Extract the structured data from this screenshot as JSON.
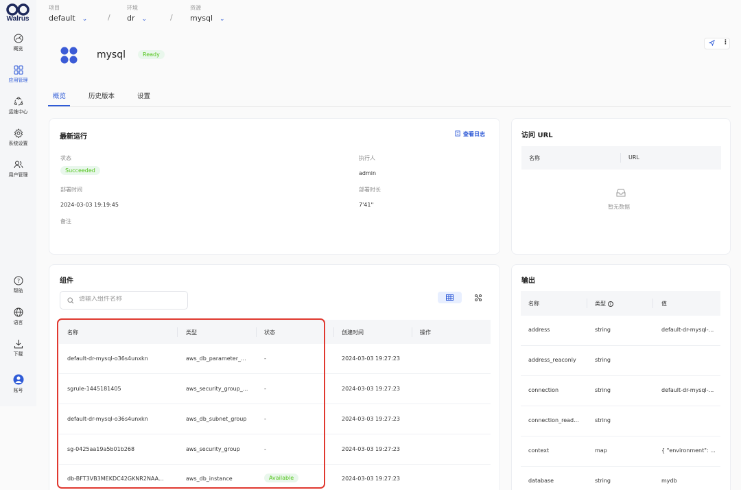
{
  "app": {
    "logo_text": "Walrus"
  },
  "sidebar": {
    "items": [
      {
        "label": "概览",
        "icon": "dashboard-icon"
      },
      {
        "label": "应用管理",
        "icon": "apps-grid-icon"
      },
      {
        "label": "运维中心",
        "icon": "ops-center-icon"
      },
      {
        "label": "系统设置",
        "icon": "gear-icon"
      },
      {
        "label": "用户管理",
        "icon": "users-icon"
      }
    ],
    "bottom": [
      {
        "label": "帮助",
        "icon": "help-icon"
      },
      {
        "label": "语言",
        "icon": "globe-icon"
      },
      {
        "label": "下载",
        "icon": "download-icon"
      },
      {
        "label": "账号",
        "icon": "account-icon"
      }
    ]
  },
  "breadcrumb": [
    {
      "label": "项目",
      "value": "default"
    },
    {
      "label": "环境",
      "value": "dr"
    },
    {
      "label": "资源",
      "value": "mysql"
    }
  ],
  "resource": {
    "name": "mysql",
    "status": "Ready"
  },
  "tabs": [
    "概览",
    "历史版本",
    "设置"
  ],
  "latest_run": {
    "title": "最新运行",
    "view_logs": "查看日志",
    "status_label": "状态",
    "status_value": "Succeeded",
    "executor_label": "执行人",
    "executor_value": "admin",
    "deploy_time_label": "部署时间",
    "deploy_time_value": "2024-03-03 19:19:45",
    "duration_label": "部署时长",
    "duration_value": "7'41''",
    "notes_label": "备注"
  },
  "access_url": {
    "title": "访问 URL",
    "columns": [
      "名称",
      "URL"
    ],
    "empty_text": "暂无数据"
  },
  "components": {
    "title": "组件",
    "search_placeholder": "请输入组件名称",
    "columns": [
      "名称",
      "类型",
      "状态",
      "创建时间",
      "操作"
    ],
    "rows": [
      {
        "name": "default-dr-mysql-o36s4unxkn",
        "type": "aws_db_parameter_...",
        "status": "-",
        "created": "2024-03-03 19:27:23"
      },
      {
        "name": "sgrule-1445181405",
        "type": "aws_security_group_...",
        "status": "-",
        "created": "2024-03-03 19:27:23"
      },
      {
        "name": "default-dr-mysql-o36s4unxkn",
        "type": "aws_db_subnet_group",
        "status": "-",
        "created": "2024-03-03 19:27:23"
      },
      {
        "name": "sg-0425aa19a5b01b268",
        "type": "aws_security_group",
        "status": "-",
        "created": "2024-03-03 19:27:23"
      },
      {
        "name": "db-BFT3VB3MEKDC42GKNR2NAA...",
        "type": "aws_db_instance",
        "status": "Available",
        "created": "2024-03-03 19:27:23"
      }
    ]
  },
  "outputs": {
    "title": "输出",
    "columns": [
      "名称",
      "类型",
      "值"
    ],
    "rows": [
      {
        "name": "address",
        "type": "string",
        "value": "default-dr-mysql-..."
      },
      {
        "name": "address_reaconly",
        "type": "string",
        "value": ""
      },
      {
        "name": "connection",
        "type": "string",
        "value": "default-dr-mysql-..."
      },
      {
        "name": "connection_read...",
        "type": "string",
        "value": ""
      },
      {
        "name": "context",
        "type": "map",
        "value": "{ \"environment\": ..."
      },
      {
        "name": "database",
        "type": "string",
        "value": "mydb"
      }
    ]
  },
  "colors": {
    "accent": "#2f5bd7",
    "success": "#52c41a",
    "highlight": "#e0382f"
  }
}
